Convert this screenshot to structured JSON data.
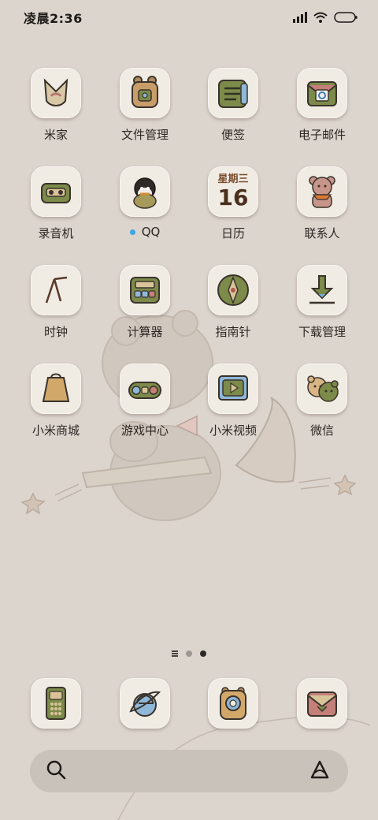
{
  "status": {
    "time": "凌晨2:36"
  },
  "apps": [
    {
      "label": "米家",
      "icon": "mijia-icon"
    },
    {
      "label": "文件管理",
      "icon": "file-manager-icon"
    },
    {
      "label": "便签",
      "icon": "notes-icon"
    },
    {
      "label": "电子邮件",
      "icon": "email-icon"
    },
    {
      "label": "录音机",
      "icon": "recorder-icon"
    },
    {
      "label": "QQ",
      "icon": "qq-icon",
      "has_new_badge": true
    },
    {
      "label": "日历",
      "icon": "calendar-icon"
    },
    {
      "label": "联系人",
      "icon": "contacts-icon"
    },
    {
      "label": "时钟",
      "icon": "clock-icon"
    },
    {
      "label": "计算器",
      "icon": "calculator-icon"
    },
    {
      "label": "指南针",
      "icon": "compass-icon"
    },
    {
      "label": "下载管理",
      "icon": "download-icon"
    },
    {
      "label": "小米商城",
      "icon": "mi-store-icon"
    },
    {
      "label": "游戏中心",
      "icon": "game-center-icon"
    },
    {
      "label": "小米视频",
      "icon": "mi-video-icon"
    },
    {
      "label": "微信",
      "icon": "wechat-icon"
    }
  ],
  "calendar": {
    "weekday": "星期三",
    "day": "16"
  },
  "dock": [
    {
      "icon": "phone-icon"
    },
    {
      "icon": "browser-icon"
    },
    {
      "icon": "camera-icon"
    },
    {
      "icon": "messages-icon"
    }
  ],
  "pager": {
    "total_pages": 2,
    "current_page": 2
  },
  "search": {
    "icon": "search-icon",
    "assistant_icon": "assistant-icon"
  },
  "colors": {
    "background": "#dcd5ce",
    "tile": "#f0ebe3",
    "badge": "#39a7e8"
  }
}
